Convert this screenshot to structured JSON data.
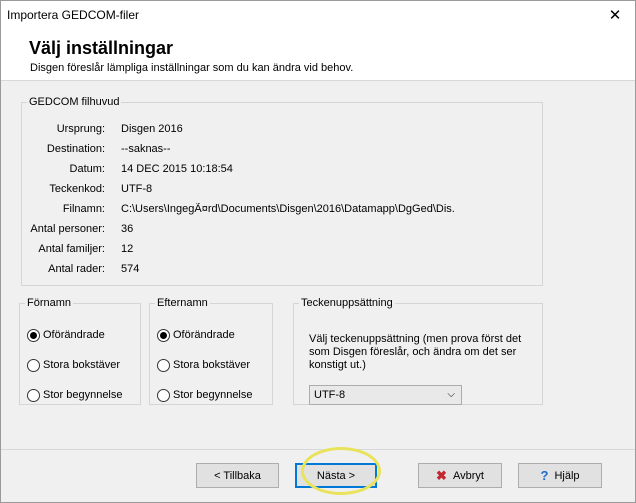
{
  "window": {
    "title": "Importera GEDCOM-filer"
  },
  "header": {
    "title": "Välj inställningar",
    "subtitle": "Disgen föreslår lämpliga inställningar som du kan ändra vid behov."
  },
  "gedcom_header": {
    "legend": "GEDCOM filhuvud",
    "rows": [
      {
        "label": "Ursprung:",
        "value": "Disgen 2016"
      },
      {
        "label": "Destination:",
        "value": "--saknas--"
      },
      {
        "label": "Datum:",
        "value": "14 DEC 2015 10:18:54"
      },
      {
        "label": "Teckenkod:",
        "value": "UTF-8"
      },
      {
        "label": "Filnamn:",
        "value": "C:\\Users\\IngegÃ¤rd\\Documents\\Disgen\\2016\\Datamapp\\DgGed\\Dis.ged"
      },
      {
        "label": "Antal personer:",
        "value": "36"
      },
      {
        "label": "Antal familjer:",
        "value": "12"
      },
      {
        "label": "Antal rader:",
        "value": "574"
      }
    ]
  },
  "fornamn": {
    "legend": "Förnamn",
    "options": [
      {
        "label": "Oförändrade",
        "selected": true
      },
      {
        "label": "Stora bokstäver",
        "selected": false
      },
      {
        "label": "Stor begynnelse",
        "selected": false
      }
    ]
  },
  "efternamn": {
    "legend": "Efternamn",
    "options": [
      {
        "label": "Oförändrade",
        "selected": true
      },
      {
        "label": "Stora bokstäver",
        "selected": false
      },
      {
        "label": "Stor begynnelse",
        "selected": false
      }
    ]
  },
  "teckenuppsattning": {
    "legend": "Teckenuppsättning",
    "description": "Välj teckenuppsättning (men prova först det som Disgen föreslår, och ändra om det ser konstigt ut.)",
    "selected": "UTF-8"
  },
  "buttons": {
    "back": "< Tillbaka",
    "next": "Nästa >",
    "cancel": "Avbryt",
    "help": "Hjälp"
  },
  "icons": {
    "close": "close-icon",
    "cancel": "x-icon",
    "help": "question-icon"
  },
  "colors": {
    "accent": "#0078d7",
    "highlight": "#e8e35a",
    "cancel_icon": "#c4262e"
  }
}
